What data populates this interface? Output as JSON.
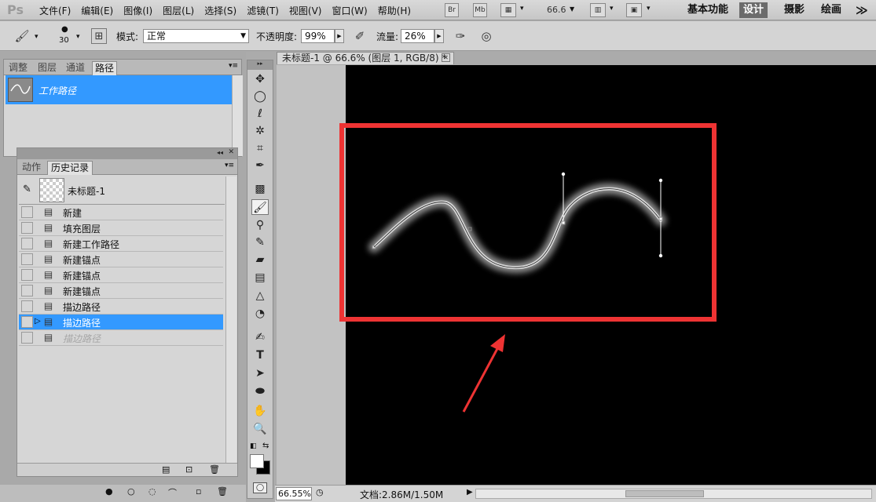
{
  "app": {
    "logo": "Ps"
  },
  "menu": [
    "文件(F)",
    "编辑(E)",
    "图像(I)",
    "图层(L)",
    "选择(S)",
    "滤镜(T)",
    "视图(V)",
    "窗口(W)",
    "帮助(H)"
  ],
  "appbar": {
    "br": "Br",
    "mb": "Mb",
    "zoom": "66.6",
    "zoom_caret": "▼"
  },
  "workspaces": [
    "基本功能",
    "设计",
    "摄影",
    "绘画"
  ],
  "workspace_active": "设计",
  "workspace_more": "≫",
  "options": {
    "brush_size": "30",
    "mode_label": "模式:",
    "mode_value": "正常",
    "opacity_label": "不透明度:",
    "opacity_value": "99%",
    "flow_label": "流量:",
    "flow_value": "26%"
  },
  "paths_panel": {
    "tabs": [
      "调整",
      "图层",
      "通道",
      "路径"
    ],
    "active_tab": "路径",
    "menu_icon": "▾≡",
    "path_item": "工作路径"
  },
  "history_panel": {
    "tabs": [
      "动作",
      "历史记录"
    ],
    "active_tab": "历史记录",
    "collapse": "◂◂",
    "close": "✕",
    "menu_icon": "▾≡",
    "snapshot": "未标题-1",
    "items": [
      {
        "label": "新建",
        "state": "normal"
      },
      {
        "label": "填充图层",
        "state": "normal"
      },
      {
        "label": "新建工作路径",
        "state": "normal"
      },
      {
        "label": "新建锚点",
        "state": "normal"
      },
      {
        "label": "新建锚点",
        "state": "normal"
      },
      {
        "label": "新建锚点",
        "state": "normal"
      },
      {
        "label": "描边路径",
        "state": "normal"
      },
      {
        "label": "描边路径",
        "state": "selected"
      },
      {
        "label": "描边路径",
        "state": "dimmed"
      }
    ]
  },
  "document": {
    "tab_title": "未标题-1 @ 66.6% (图层 1, RGB/8) *",
    "close": "✕"
  },
  "status": {
    "zoom": "66.55%",
    "doc_info": "文档:2.86M/1.50M",
    "arrow": "▶"
  },
  "colors": {
    "selection_blue": "#3399ff",
    "highlight_red": "#ee3333",
    "canvas_bg": "#000000"
  }
}
